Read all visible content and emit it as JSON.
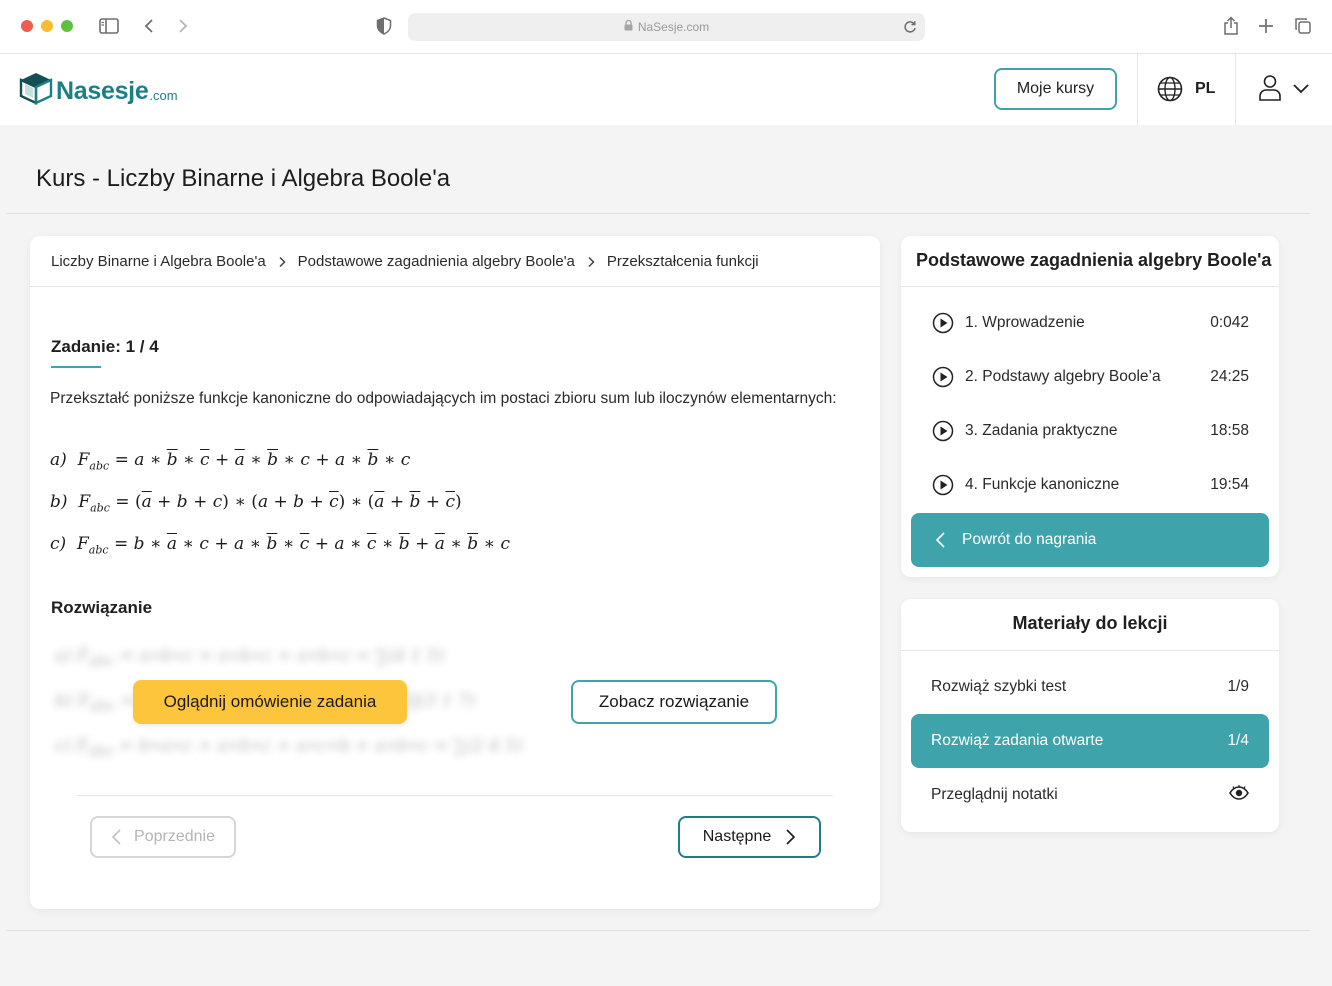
{
  "browser": {
    "url": "NaSesje.com"
  },
  "header": {
    "logo_text": "Nasesje",
    "logo_suffix": ".com",
    "my_courses": "Moje kursy",
    "language": "PL"
  },
  "page": {
    "title": "Kurs - Liczby Binarne i Algebra Boole'a"
  },
  "breadcrumb": [
    "Liczby Binarne i Algebra Boole'a",
    "Podstawowe zagadnienia algebry Boole'a",
    "Przekształcenia funkcji"
  ],
  "task": {
    "title": "Zadanie: 1 / 4",
    "text": "Przekształć poniższe funkcje kanoniczne do odpowiadających im postaci zbioru sum lub iloczynów elementarnych:",
    "formulas": {
      "a_label": "a)",
      "b_label": "b)",
      "c_label": "c)"
    },
    "solution_title": "Rozwiązanie",
    "watch_button": "Oglądnij omówienie zadania",
    "see_solution_button": "Zobacz rozwiązanie",
    "prev_button": "Poprzednie",
    "next_button": "Następne"
  },
  "lessons": {
    "title": "Podstawowe zagadnienia algebry Boole'a",
    "items": [
      {
        "label": "1. Wprowadzenie",
        "time": "0:042"
      },
      {
        "label": "2. Podstawy algebry Boole’a",
        "time": "24:25"
      },
      {
        "label": "3. Zadania praktyczne",
        "time": "18:58"
      },
      {
        "label": "4. Funkcje kanoniczne",
        "time": "19:54"
      }
    ],
    "back_button": "Powrót do nagrania"
  },
  "materials": {
    "title": "Materiały do lekcji",
    "items": [
      {
        "label": "Rozwiąż szybki test",
        "count": "1/9"
      },
      {
        "label": "Rozwiąż zadania otwarte",
        "count": "1/4"
      },
      {
        "label": "Przeglądnij notatki"
      }
    ]
  }
}
